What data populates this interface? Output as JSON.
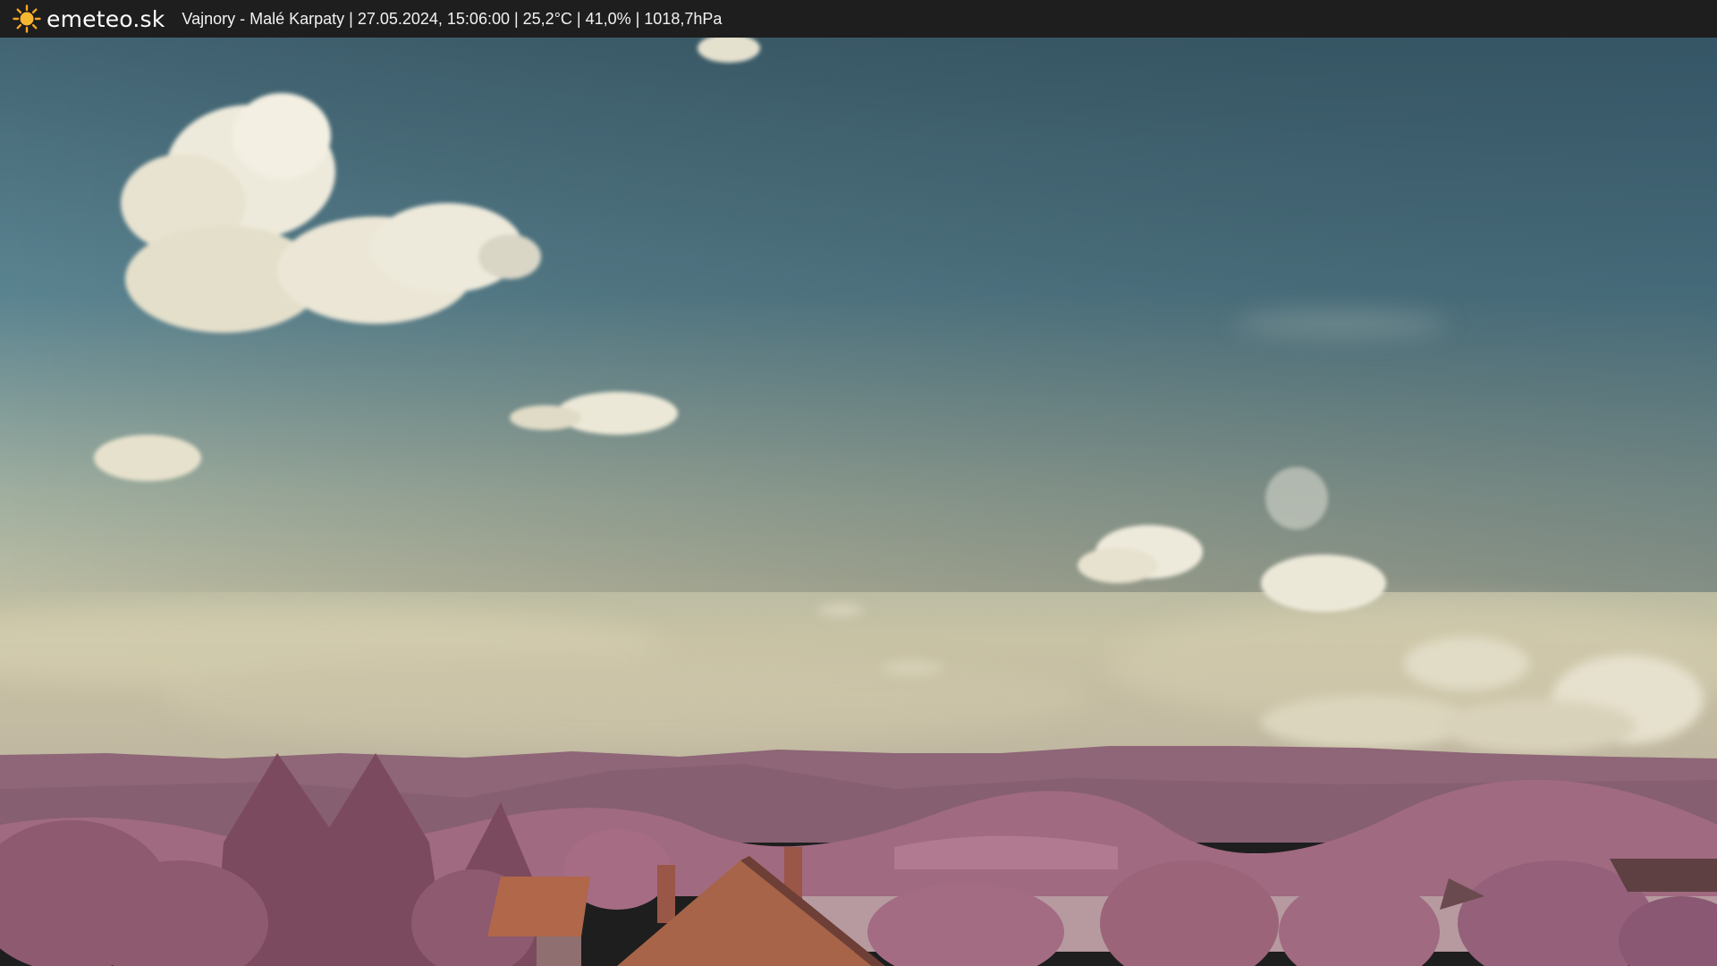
{
  "header": {
    "logo_icon": "sun-icon",
    "brand": "emeteo.sk",
    "caption": "Vajnory - Malé Karpaty | 27.05.2024, 15:06:00 | 25,2°C | 41,0% | 1018,7hPa"
  },
  "colors": {
    "bar": "#1e1e1e",
    "sun": "#f5a623",
    "sky_top": "#3f5f70",
    "sky_mid": "#6b8f98",
    "sky_horizon": "#c9c3a5",
    "hills": "#8d6677",
    "foliage": "#a46e84",
    "roof": "#b0674a"
  }
}
